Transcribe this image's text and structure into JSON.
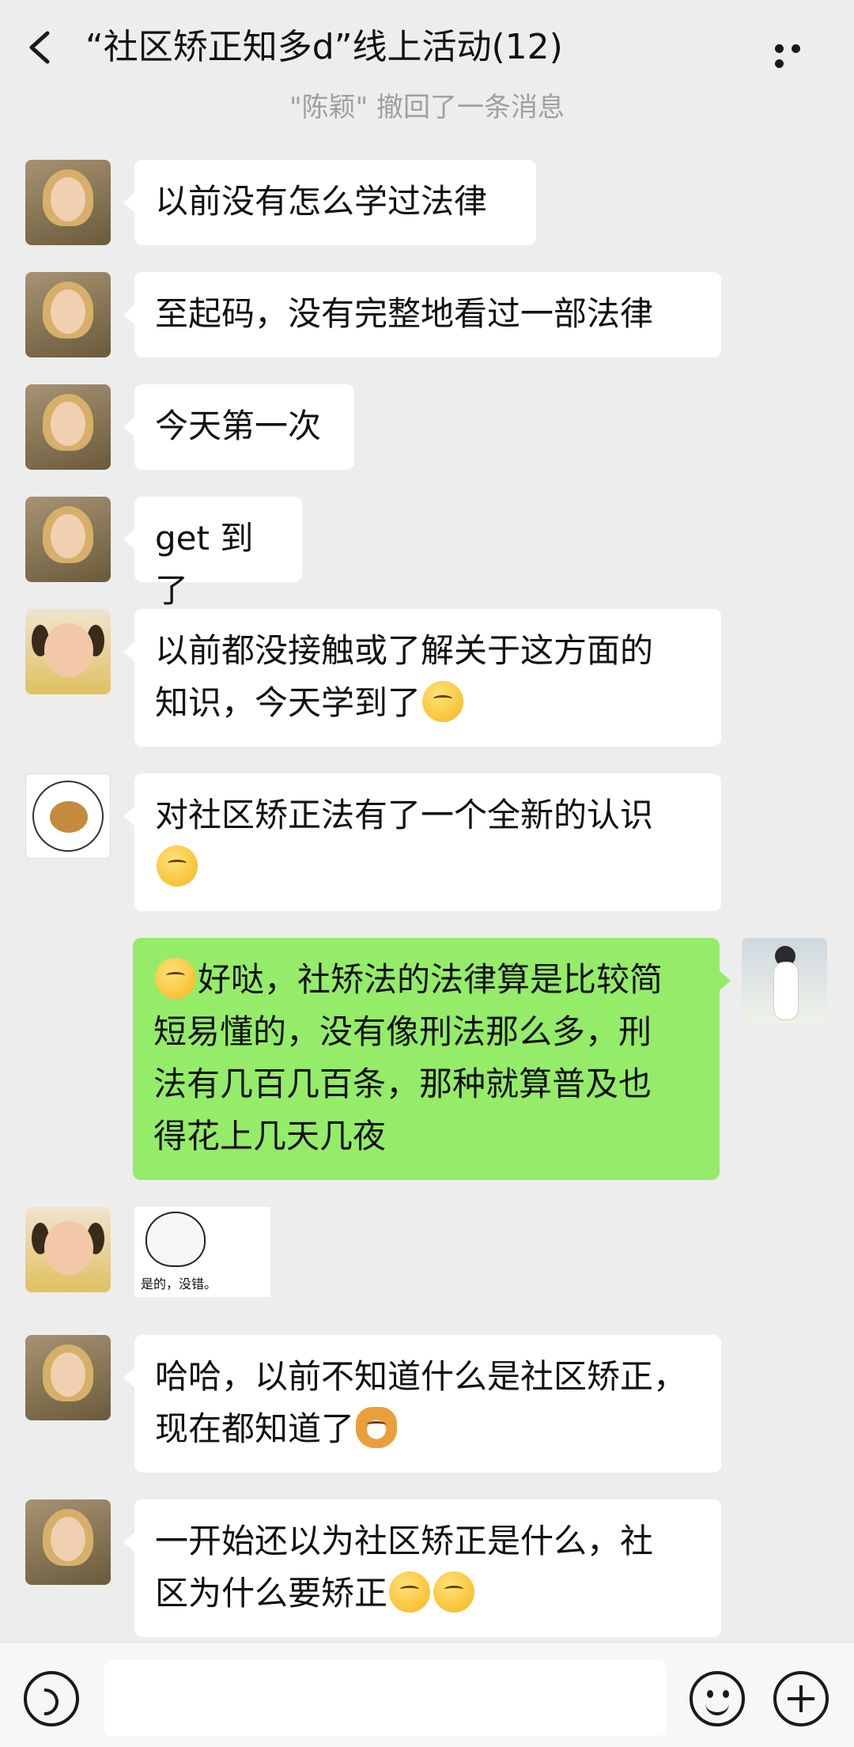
{
  "header": {
    "title": "“社区矫正知多d”线上活动(12)"
  },
  "system_message": "\"陈颖\" 撤回了一条消息",
  "messages": [
    {
      "side": "left",
      "avatar": "woman-avatar",
      "text": "以前没有怎么学过法律"
    },
    {
      "side": "left",
      "avatar": "woman-avatar",
      "text": "至起码，没有完整地看过一部法律"
    },
    {
      "side": "left",
      "avatar": "woman-avatar",
      "text": "今天第一次"
    },
    {
      "side": "left",
      "avatar": "woman-avatar",
      "text": "get 到了"
    },
    {
      "side": "left",
      "avatar": "baby-avatar",
      "text": "以前都没接触或了解关于这方面的\n知识，今天学到了"
    },
    {
      "side": "left",
      "avatar": "bear-avatar",
      "text": "对社区矫正法有了一个全新的认识"
    },
    {
      "side": "right",
      "avatar": "girl-avatar",
      "text": "好哒，社矫法的法律算是比较简\n短易懂的，没有像刑法那么多，刑\n法有几百几百条，那种就算普及也\n得花上几天几夜"
    },
    {
      "side": "left",
      "avatar": "baby-avatar",
      "sticker_text": "是的，没错。"
    },
    {
      "side": "left",
      "avatar": "woman-avatar",
      "text": "哈哈，以前不知道什么是社区矫正，\n现在都知道了"
    },
    {
      "side": "left",
      "avatar": "woman-avatar",
      "text": "一开始还以为社区矫正是什么，社\n区为什么要矫正"
    }
  ],
  "icons": {
    "back": "chevron-left-icon",
    "more": "more-dots-icon",
    "voice": "voice-icon",
    "emoji": "emoji-icon",
    "plus": "plus-icon"
  },
  "colors": {
    "background": "#ededed",
    "incoming_bubble": "#ffffff",
    "outgoing_bubble": "#95ec69"
  }
}
